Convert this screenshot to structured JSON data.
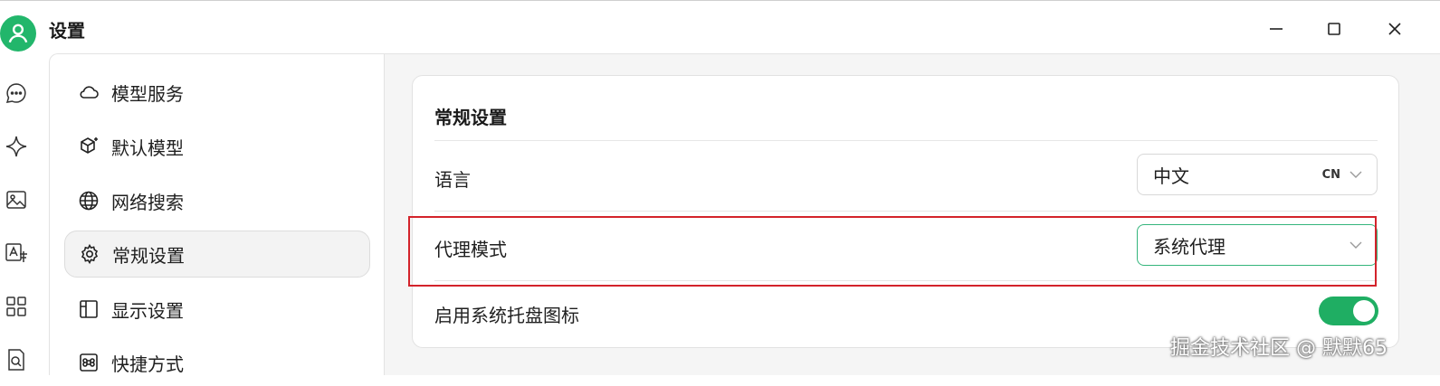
{
  "window": {
    "title": "设置",
    "controls": [
      "minimize-icon",
      "maximize-icon",
      "close-icon"
    ]
  },
  "rail": {
    "icons": [
      "chat-icon",
      "sparkle-icon",
      "image-icon",
      "translate-icon",
      "apps-icon",
      "file-search-icon"
    ]
  },
  "sidebar": {
    "items": [
      {
        "label": "模型服务",
        "icon": "cloud-icon"
      },
      {
        "label": "默认模型",
        "icon": "cube-sparkle-icon"
      },
      {
        "label": "网络搜索",
        "icon": "globe-icon"
      },
      {
        "label": "常规设置",
        "icon": "gear-icon",
        "active": true
      },
      {
        "label": "显示设置",
        "icon": "layout-icon"
      },
      {
        "label": "快捷方式",
        "icon": "command-icon"
      }
    ]
  },
  "general": {
    "title": "常规设置",
    "language": {
      "label": "语言",
      "value": "中文",
      "tag": "CN"
    },
    "proxy": {
      "label": "代理模式",
      "value": "系统代理"
    },
    "tray": {
      "label": "启用系统托盘图标",
      "enabled": true
    }
  },
  "colors": {
    "accent": "#1fae63",
    "highlight_border": "#d3232b"
  },
  "watermark": "掘金技术社区 @ 默默65"
}
